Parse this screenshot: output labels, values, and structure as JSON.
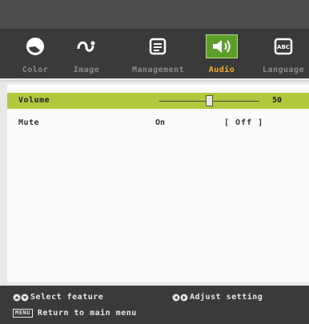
{
  "tabs": [
    {
      "label": "Color",
      "icon": "color-icon"
    },
    {
      "label": "Image",
      "icon": "image-icon"
    },
    {
      "label": "Management",
      "icon": "management-icon"
    },
    {
      "label": "Audio",
      "icon": "audio-icon",
      "active": true
    },
    {
      "label": "Language",
      "icon": "language-icon"
    }
  ],
  "language_icon_text": "ABC",
  "rows": {
    "volume": {
      "label": "Volume",
      "value": "50",
      "level": 0.5
    },
    "mute": {
      "label": "Mute",
      "option_on": "On",
      "option_off": "[ Off ]"
    }
  },
  "footer": {
    "select_hint": "Select feature",
    "adjust_hint": "Adjust setting",
    "menu_key": "MENU",
    "return_hint": "Return to main menu"
  },
  "colors": {
    "accent": "#5ca02b",
    "selected_row": "#b2c83c",
    "active_label": "#f2b01e"
  }
}
